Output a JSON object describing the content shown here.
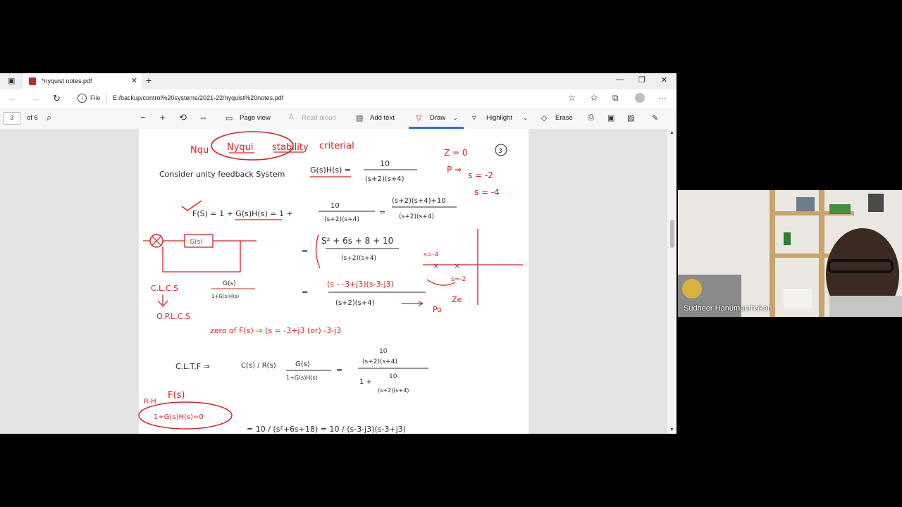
{
  "browser": {
    "tab_title": "*nyquist notes.pdf",
    "address": {
      "file_label": "File",
      "url": "E:/backup/control%20systems/2021-22/nyquist%20notes.pdf"
    }
  },
  "pdf_toolbar": {
    "page_number": "3",
    "page_total": "of 6",
    "page_view": "Page view",
    "read_aloud": "Read aloud",
    "add_text": "Add text",
    "draw": "Draw",
    "highlight": "Highlight",
    "erase": "Erase"
  },
  "icons": [
    "sidebar-toggle-icon",
    "pdf-icon",
    "close-icon",
    "plus-icon",
    "minimize-icon",
    "restore-icon",
    "back-icon",
    "forward-icon",
    "refresh-icon",
    "info-icon",
    "favorite-add-icon",
    "favorites-icon",
    "collections-icon",
    "profile-icon",
    "more-icon",
    "search-icon",
    "zoom-out-icon",
    "zoom-in-icon",
    "rotate-icon",
    "fit-page-icon",
    "page-view-icon",
    "read-aloud-icon",
    "add-text-icon",
    "draw-icon",
    "highlight-icon",
    "erase-icon",
    "print-icon",
    "save-icon",
    "save-as-icon",
    "pin-icon"
  ],
  "notes": {
    "title_words": [
      "Nqu",
      "Nyqui",
      "stability",
      "criterial"
    ],
    "line_consider": "Consider unity feedback System",
    "gh": "G(s)H(s) =",
    "frac_top": "10",
    "frac_bottom": "(s+2)(s+4)",
    "z0": "Z = 0",
    "page_circle": "3",
    "p_pole": "P ⇒",
    "s_m2": "s = -2",
    "s_m4": "s = -4",
    "fs_line": "F(S) = 1 + G(s)H(s) = 1 +",
    "fs_num": "(s+2)(s+4)+10",
    "fs_den": "(s+2)(s+4)",
    "eq_s2": "S² + 6s + 8 + 10",
    "block_g": "G(s)",
    "s_m4_plot": "s=-4",
    "s_m2_plot": "s=-2",
    "clcs": "C.L.C.S",
    "frac_g": "G(s)",
    "frac_1gh": "1+G(s)H(s)",
    "roots": "(s - -3+j3)(s-3-j3)",
    "po": "Po",
    "ze": "Ze",
    "olcs": "O.P.L.C.S",
    "zero_line": "zero of  F(s) ⇒ (s = -3+j3  (or)  -3-j3",
    "cltf": "C.L.T.F ⇒",
    "cs_rs": "C(s) / R(s)",
    "one_plus": "1 +",
    "rh": "R-H",
    "fs_red": "F(s)",
    "char_eq": "1+G(s)H(s)=0",
    "bottom_eq": "= 10 / (s²+6s+18) = 10 / (s-3-j3)(s-3+j3)"
  },
  "webcam": {
    "name": "Sudheer Hanumanthakari"
  },
  "colors": {
    "ink_red": "#d32323",
    "ink_black": "#2a2a2a",
    "accent": "#2f6fd1"
  }
}
